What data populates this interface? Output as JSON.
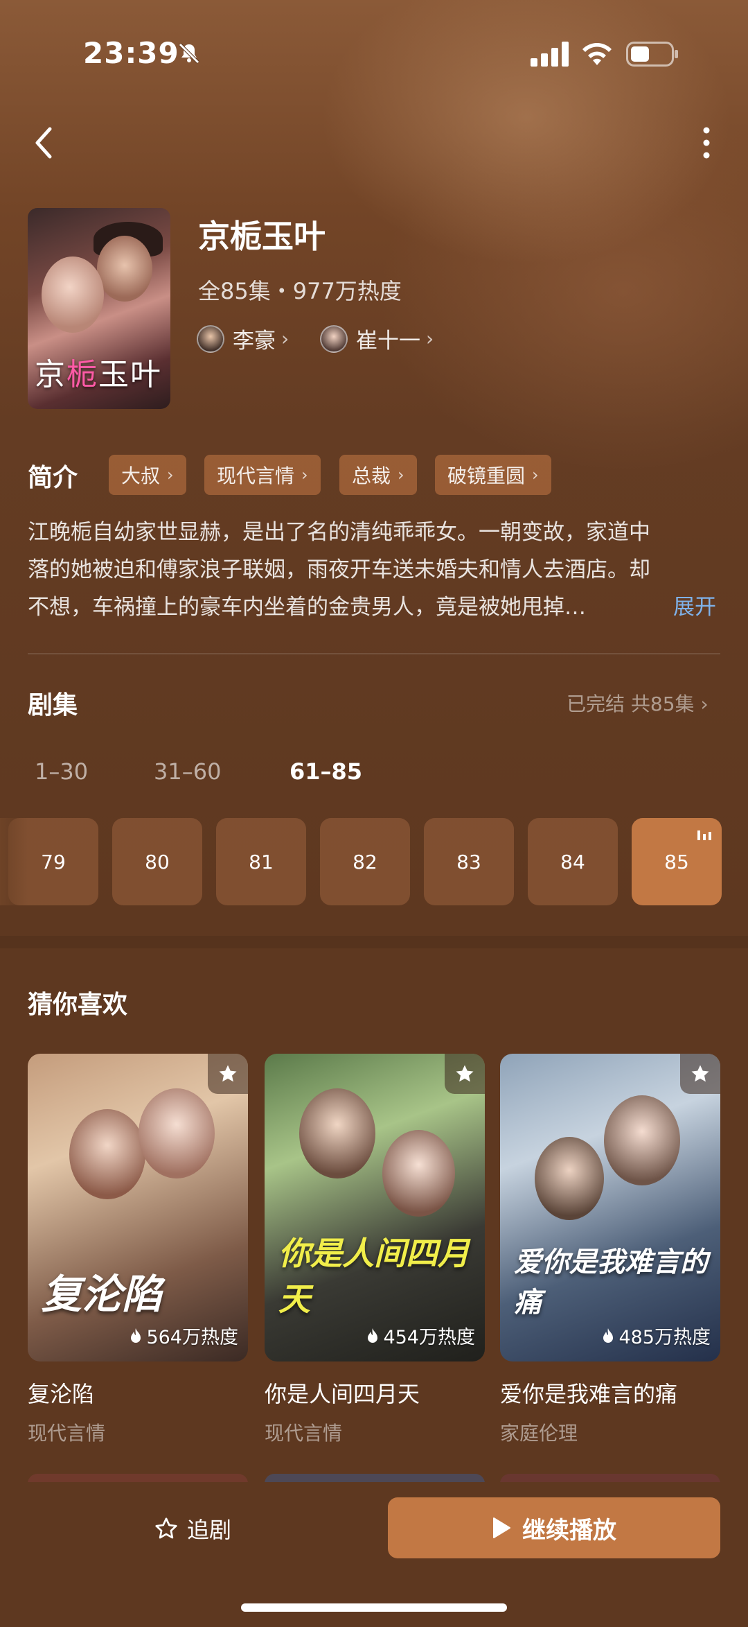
{
  "status_bar": {
    "time": "23:39"
  },
  "drama": {
    "title": "京栀玉叶",
    "poster_title_left": "京",
    "poster_title_pink": "栀",
    "poster_title_right": "玉叶",
    "meta": "全85集・977万热度",
    "actors": [
      {
        "name": "李豪"
      },
      {
        "name": "崔十一"
      }
    ]
  },
  "intro": {
    "heading": "简介",
    "tags": [
      "大叔",
      "现代言情",
      "总裁",
      "破镜重圆"
    ],
    "lines": [
      "江晚栀自幼家世显赫，是出了名的清纯乖乖女。一朝变故，家道中",
      "落的她被迫和傅家浪子联姻，雨夜开车送未婚夫和情人去酒店。却",
      "不想，车祸撞上的豪车内坐着的金贵男人，竟是被她甩掉…"
    ],
    "expand_label": "展开"
  },
  "episodes": {
    "heading": "剧集",
    "status": "已完结 共85集",
    "ranges": [
      "1–30",
      "31–60",
      "61–85"
    ],
    "active_range": "61–85",
    "items": [
      "79",
      "80",
      "81",
      "82",
      "83",
      "84",
      "85"
    ],
    "playing": "85"
  },
  "recommend": {
    "heading": "猜你喜欢",
    "cards": [
      {
        "title": "复沦陷",
        "genre": "现代言情",
        "heat": "564万热度",
        "poster_text": "复沦陷"
      },
      {
        "title": "你是人间四月天",
        "genre": "现代言情",
        "heat": "454万热度",
        "poster_text": "你是人间四月天"
      },
      {
        "title": "爱你是我难言的痛",
        "genre": "家庭伦理",
        "heat": "485万热度",
        "poster_text": "爱你是我难言的痛"
      }
    ]
  },
  "bottom": {
    "follow_label": "追剧",
    "play_label": "继续播放"
  },
  "colors": {
    "background": "#5e3820",
    "accent": "#c27844",
    "link": "#7fb2ea"
  }
}
